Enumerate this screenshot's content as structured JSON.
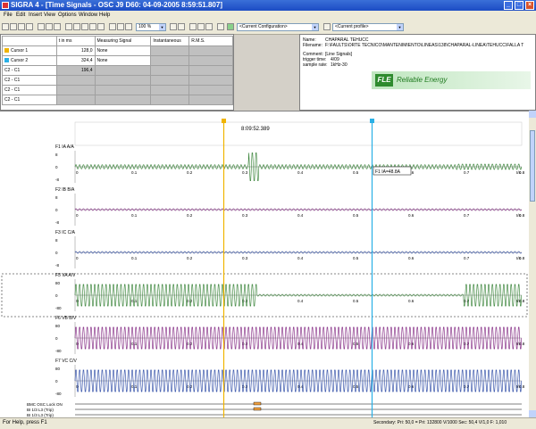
{
  "window": {
    "title": "SIGRA 4 - [Time Signals - OSC J9 D60: 04-09-2005 8:59:51.807]",
    "controls": {
      "minimize": "_",
      "maximize": "□",
      "close": "×"
    }
  },
  "menu": [
    "File",
    "Edit",
    "Insert",
    "View",
    "Options",
    "Window",
    "Help"
  ],
  "toolbar": {
    "zoom": "100 %",
    "configuration": "<Current Configuration>",
    "signal_combo": "<Current profile>"
  },
  "cursor_table": {
    "headers": [
      "",
      "t in ms",
      "Measuring Signal",
      "Instantaneous",
      "R.M.S."
    ],
    "rows": [
      {
        "label": "Cursor 1",
        "color": "#f0b400",
        "t": "128,0",
        "signal": "None",
        "inst": "",
        "rms": ""
      },
      {
        "label": "Cursor 2",
        "color": "#2ab0e6",
        "t": "324,4",
        "signal": "None",
        "inst": "",
        "rms": ""
      },
      {
        "label": "C2 - C1",
        "color": "",
        "t": "196,4",
        "signal": "",
        "inst": "",
        "rms": ""
      },
      {
        "label": "C2 - C1",
        "color": "",
        "t": "",
        "signal": "",
        "inst": "",
        "rms": ""
      },
      {
        "label": "C2 - C1",
        "color": "",
        "t": "",
        "signal": "",
        "inst": "",
        "rms": ""
      },
      {
        "label": "C2 - C1",
        "color": "",
        "t": "",
        "signal": "",
        "inst": "",
        "rms": ""
      }
    ]
  },
  "info": {
    "name_label": "Name:",
    "name_value": "CHAPARAL TEHUCC",
    "filename_label": "Filename:",
    "filename_value": "F:\\FAULTS\\ORTE TECNICO\\MANTENIMIENTO\\LINEAS\\138\\CHAPARAL-LINEA\\TEHUCC\\FALLA T",
    "comment_label": "Comment:",
    "comment_value": "[Line Signals]",
    "trigger_label": "trigger time:",
    "trigger_value": "4/09",
    "sample_label": "sample rate:",
    "sample_value": "1kHz-30"
  },
  "logo": {
    "mark": "FLE",
    "text": "Reliable Energy"
  },
  "chart": {
    "header_time": "8:09:52.389",
    "cursors": {
      "cursor1_color": "#f0b400",
      "cursor2_color": "#2ab0e6"
    },
    "x_ticks": [
      "0",
      "0.1",
      "0.2",
      "0.3",
      "0.4",
      "0.5",
      "0.6",
      "0.7",
      "0.8"
    ],
    "x_unit": "t/s",
    "signals": [
      {
        "name": "F1 IA A/A",
        "color": "#2a7a2a",
        "ticks": [
          "8",
          "0",
          "-8"
        ]
      },
      {
        "name": "F2 IB B/A",
        "color": "#7a1a7a",
        "ticks": [
          "8",
          "0",
          "-8"
        ]
      },
      {
        "name": "F3 IC C/A",
        "color": "#2040a0",
        "ticks": [
          "8",
          "0",
          "-8"
        ]
      },
      {
        "name": "F5 VA A/V",
        "color": "#2a7a2a",
        "ticks": [
          "80",
          "0",
          "-80"
        ]
      },
      {
        "name": "F6 VB B/V",
        "color": "#7a1a7a",
        "ticks": [
          "80",
          "0",
          "-80"
        ]
      },
      {
        "name": "F7 VC C/V",
        "color": "#2040a0",
        "ticks": [
          "80",
          "0",
          "-80"
        ]
      }
    ],
    "annotation": "F1 IA=48.8A",
    "binary": [
      "BMC OSC Lock ON",
      "BI 1/3 L3 (Trip)",
      "BI 1/3 L3 (Trip)"
    ]
  },
  "status": {
    "left": "For Help, press F1",
    "right": "Secondary: Pri: 50,0 = Pri: 132800 V/1000 Sec: 50,4 V/1,0 F: 1,010"
  }
}
